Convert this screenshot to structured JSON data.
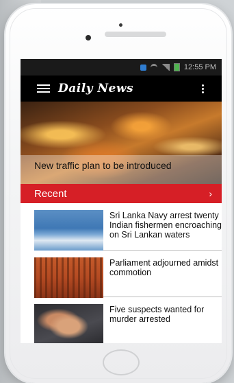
{
  "statusbar": {
    "time": "12:55 PM"
  },
  "appbar": {
    "logo": "Daily News"
  },
  "hero": {
    "caption": "New traffic plan to be introduced"
  },
  "recent": {
    "label": "Recent",
    "chevron": "›"
  },
  "articles": [
    {
      "title": "Sri Lanka Navy arrest twenty Indian fishermen encroaching on Sri Lankan waters"
    },
    {
      "title": "Parliament adjourned amidst commotion"
    },
    {
      "title": "Five suspects wanted for murder arrested"
    }
  ]
}
